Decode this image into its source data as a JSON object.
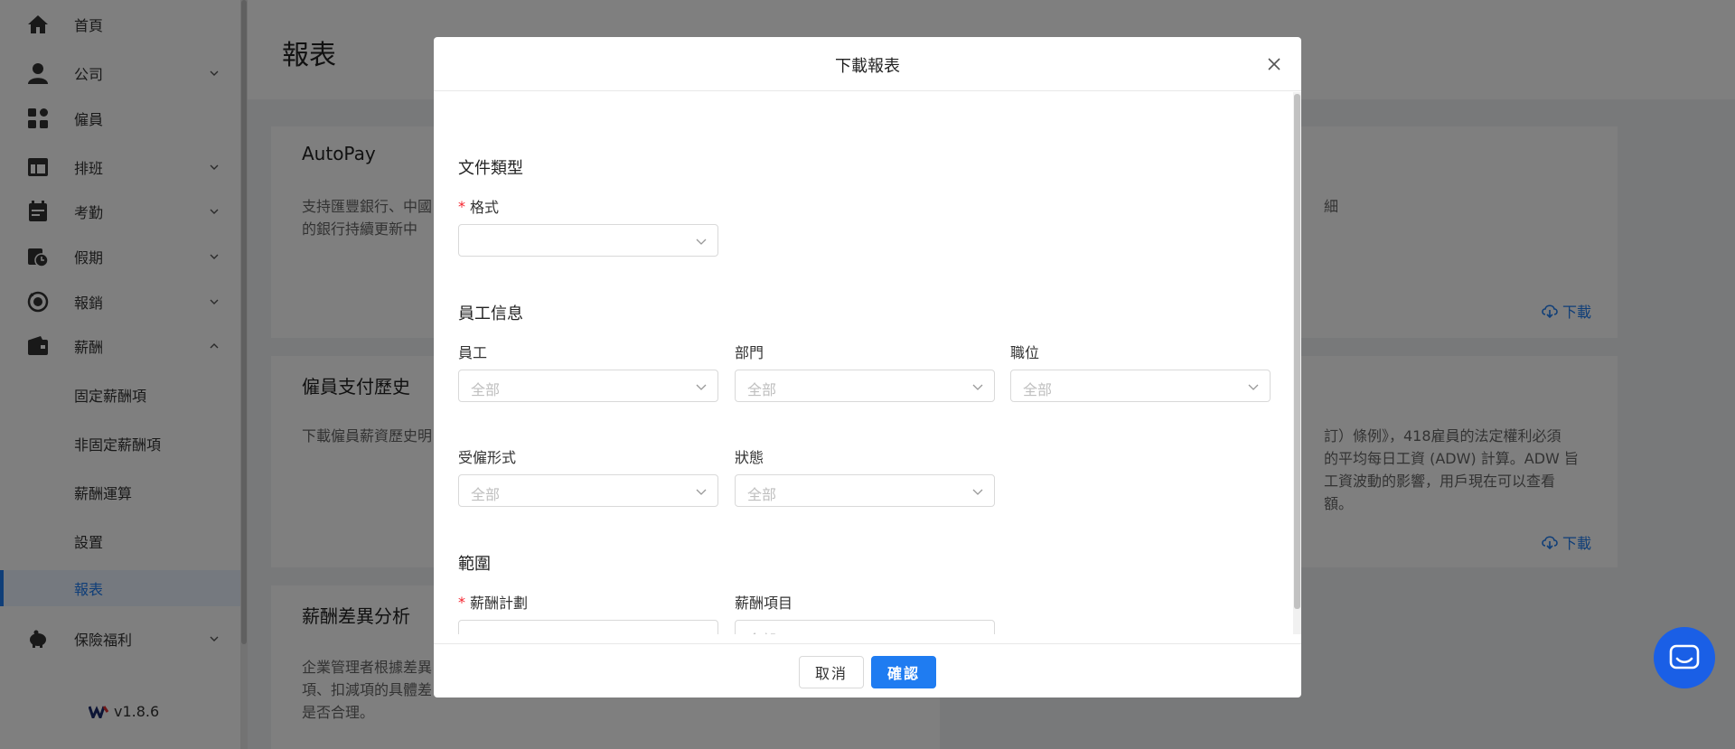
{
  "sidebar": {
    "items": [
      {
        "label": "首頁",
        "icon": "home-icon",
        "has_chevron": false
      },
      {
        "label": "公司",
        "icon": "user-icon",
        "has_chevron": true
      },
      {
        "label": "僱員",
        "icon": "grid-icon",
        "has_chevron": false
      },
      {
        "label": "排班",
        "icon": "layout-icon",
        "has_chevron": true
      },
      {
        "label": "考勤",
        "icon": "calendar-icon",
        "has_chevron": true
      },
      {
        "label": "假期",
        "icon": "calendar-clock-icon",
        "has_chevron": true
      },
      {
        "label": "報銷",
        "icon": "refund-icon",
        "has_chevron": true
      },
      {
        "label": "薪酬",
        "icon": "wallet-icon",
        "has_chevron": true
      }
    ],
    "sub_items": [
      {
        "label": "固定薪酬項"
      },
      {
        "label": "非固定薪酬項"
      },
      {
        "label": "薪酬運算"
      },
      {
        "label": "設置"
      },
      {
        "label": "報表",
        "active": true
      }
    ],
    "insurance": {
      "label": "保險福利",
      "icon": "piggy-bank-icon"
    },
    "version": "v1.8.6"
  },
  "main": {
    "title": "報表",
    "cards": [
      {
        "title": "AutoPay",
        "desc_lines": [
          "支持匯豐銀行、中國",
          "的銀行持續更新中"
        ]
      },
      {
        "title": "僱員支付歷史",
        "desc_lines": [
          "下載僱員薪資歷史明"
        ]
      },
      {
        "title": "薪酬差異分析",
        "desc_lines": [
          "企業管理者根據差異",
          "項、扣減項的具體差",
          "是否合理。"
        ]
      }
    ],
    "right_cards": [
      {
        "desc_lines": [
          "細"
        ],
        "download_label": "下載"
      },
      {
        "desc_lines": [
          "訂）條例》，418雇員的法定權利必須",
          "的平均每日工資 (ADW) 計算。ADW 旨",
          "工資波動的影響，用戶現在可以查看",
          "額。"
        ],
        "download_label": "下載"
      }
    ]
  },
  "modal": {
    "title": "下載報表",
    "sections": {
      "doc_type": "文件類型",
      "employee_info": "員工信息",
      "scope": "範圍"
    },
    "fields": {
      "format": {
        "label": "格式",
        "required": true,
        "value": ""
      },
      "employee": {
        "label": "員工",
        "value": "全部"
      },
      "department": {
        "label": "部門",
        "value": "全部"
      },
      "position": {
        "label": "職位",
        "value": "全部"
      },
      "employment_type": {
        "label": "受僱形式",
        "value": "全部"
      },
      "status": {
        "label": "狀態",
        "value": "全部"
      },
      "payroll_plan": {
        "label": "薪酬計劃",
        "required": true,
        "value": ""
      },
      "payroll_item": {
        "label": "薪酬項目",
        "value": "全部"
      }
    },
    "cancel_label": "取消",
    "confirm_label": "確認"
  },
  "colors": {
    "accent": "#1f7cf1",
    "required": "#f5222d",
    "chat": "#1a5fe6"
  }
}
